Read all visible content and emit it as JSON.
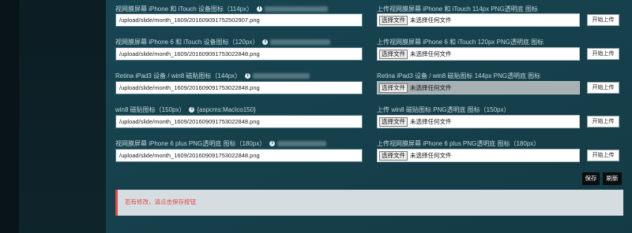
{
  "rows": [
    {
      "left_label": "视网膜屏幕 iPhone 和 iTouch 设备图标（114px）",
      "left_hint": "",
      "path_value": "/upload/slide/month_1609/201609091752502907.png",
      "right_label": "上传视网膜屏幕 iPhone 和 iTouch 114px PNG透明底 图标",
      "choose_label": "选择文件",
      "no_file_label": "未选择任何文件",
      "upload_label": "开始上传"
    },
    {
      "left_label": "视网膜屏幕 iPhone 6 和 iTouch 设备图标（120px）",
      "left_hint": "",
      "path_value": "/upload/slide/month_1609/201609091753022848.png",
      "right_label": "上传视网膜屏幕 iPhone 6 和 iTouch 120px PNG透明底 图标",
      "choose_label": "选择文件",
      "no_file_label": "未选择任何文件",
      "upload_label": "开始上传"
    },
    {
      "left_label": "Retina iPad3 设备 / win8 磁贴图标（144px）",
      "left_hint": "",
      "path_value": "/upload/slide/month_1609/201609091753022848.png",
      "right_label": "Retina iPad3 设备 / win8 磁贴图标 144px PNG透明底 图标",
      "choose_label": "选择文件",
      "no_file_label": "未选择任何文件",
      "upload_label": "开始上传"
    },
    {
      "left_label": "win8 磁贴图标（150px）",
      "left_hint": "{aspcms:MacIco150}",
      "path_value": "/upload/slide/month_1609/201609091753022848.png",
      "right_label": "上传 win8 磁贴图标 PNG透明底 图标（150px）",
      "choose_label": "选择文件",
      "no_file_label": "未选择任何文件",
      "upload_label": "开始上传"
    },
    {
      "left_label": "视网膜屏幕 iPhone 6 plus PNG透明底 图标（180px）",
      "left_hint": "",
      "path_value": "/upload/slide/month_1609/201609091753022848.png",
      "right_label": "上传视网膜屏幕 iPhone 6 plus PNG透明底 图标（180px）",
      "choose_label": "选择文件",
      "no_file_label": "未选择任何文件",
      "upload_label": "开始上传"
    }
  ],
  "actions": {
    "save_label": "保存",
    "refresh_label": "刷新"
  },
  "alert": {
    "message": "若有修改，请点击保存按钮"
  },
  "colors": {
    "alert_text": "#e04848",
    "button_dark": "#0a0d0e",
    "background": "#173a45"
  }
}
